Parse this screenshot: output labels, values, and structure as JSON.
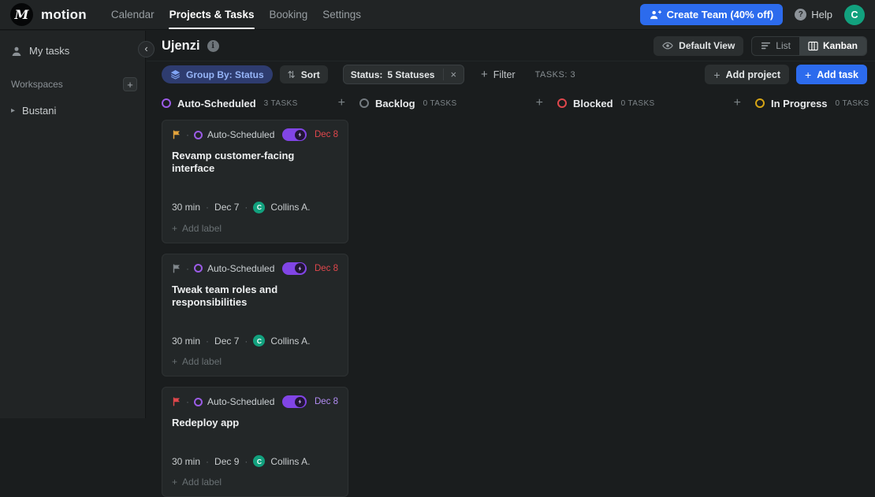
{
  "nav": {
    "logo_letter": "M",
    "brand": "motion",
    "items": [
      {
        "label": "Calendar"
      },
      {
        "label": "Projects & Tasks"
      },
      {
        "label": "Booking"
      },
      {
        "label": "Settings"
      }
    ],
    "create_team_label": "Create Team (40% off)",
    "help_label": "Help",
    "avatar_initial": "C"
  },
  "sidebar": {
    "my_tasks": "My tasks",
    "workspaces_label": "Workspaces",
    "workspaces": [
      {
        "label": "Bustani"
      }
    ]
  },
  "header": {
    "title": "Ujenzi",
    "default_view_label": "Default View",
    "list_label": "List",
    "kanban_label": "Kanban"
  },
  "toolbar": {
    "group_by_label": "Group By: Status",
    "sort_label": "Sort",
    "status_chip_label": "Status:",
    "status_chip_value": "5 Statuses",
    "filter_label": "Filter",
    "tasks_count_label": "TASKS: 3",
    "add_project_label": "Add project",
    "add_task_label": "Add task"
  },
  "board": {
    "columns": [
      {
        "name": "Auto-Scheduled",
        "count": "3 TASKS",
        "color": "#9b5ce6"
      },
      {
        "name": "Backlog",
        "count": "0 TASKS",
        "color": "#747b80"
      },
      {
        "name": "Blocked",
        "count": "0 TASKS",
        "color": "#e0474c"
      },
      {
        "name": "In Progress",
        "count": "0 TASKS",
        "color": "#d7a515"
      }
    ],
    "cards": [
      {
        "status": "Auto-Scheduled",
        "flag_color": "#e3a33b",
        "schedule_date": "Dec 8",
        "schedule_date_color": "#e0474c",
        "title": "Revamp customer-facing interface",
        "duration": "30 min",
        "due": "Dec 7",
        "assignee_initial": "C",
        "assignee": "Collins A.",
        "add_label": "Add label"
      },
      {
        "status": "Auto-Scheduled",
        "flag_color": "#80878c",
        "schedule_date": "Dec 8",
        "schedule_date_color": "#e0474c",
        "title": "Tweak team roles and responsibilities",
        "duration": "30 min",
        "due": "Dec 7",
        "assignee_initial": "C",
        "assignee": "Collins A.",
        "add_label": "Add label"
      },
      {
        "status": "Auto-Scheduled",
        "flag_color": "#e0474c",
        "schedule_date": "Dec 8",
        "schedule_date_color": "#b18cf2",
        "title": "Redeploy app",
        "duration": "30 min",
        "due": "Dec 9",
        "assignee_initial": "C",
        "assignee": "Collins A.",
        "add_label": "Add label"
      }
    ]
  },
  "icons": {
    "collapse_chevron": "‹",
    "workspace_chevron": "▸",
    "plus": "+",
    "close": "×",
    "dot": "·",
    "sort_arrows": "⇅",
    "help_glyph": "?",
    "info_glyph": "i"
  },
  "colors": {
    "accent_blue": "#2c6bed",
    "purple": "#9b5ce6",
    "toggle_purple": "#8145e6",
    "avatar_green": "#12a17e",
    "overdue_red": "#e0474c",
    "group_by_bg": "#2e3c6f",
    "group_by_text": "#96b5f8"
  }
}
